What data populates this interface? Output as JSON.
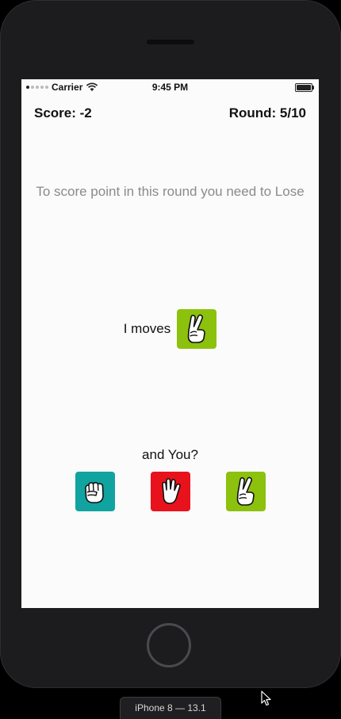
{
  "status_bar": {
    "carrier": "Carrier",
    "time": "9:45 PM"
  },
  "game": {
    "score": "Score: -2",
    "round": "Round: 5/10",
    "instruction": "To score point in this round you need to Lose",
    "ai_label": "I moves",
    "ai_move": {
      "icon": "scissors-hand-icon",
      "color": "#8cc10d"
    },
    "prompt": "and You?",
    "choices": [
      {
        "id": "rock",
        "icon": "fist-icon",
        "color": "#11a3a0"
      },
      {
        "id": "paper",
        "icon": "open-hand-icon",
        "color": "#e8121c"
      },
      {
        "id": "scissors",
        "icon": "scissors-hand-icon",
        "color": "#8cc10d"
      }
    ]
  },
  "simulator": {
    "device_label": "iPhone 8 — 13.1"
  }
}
